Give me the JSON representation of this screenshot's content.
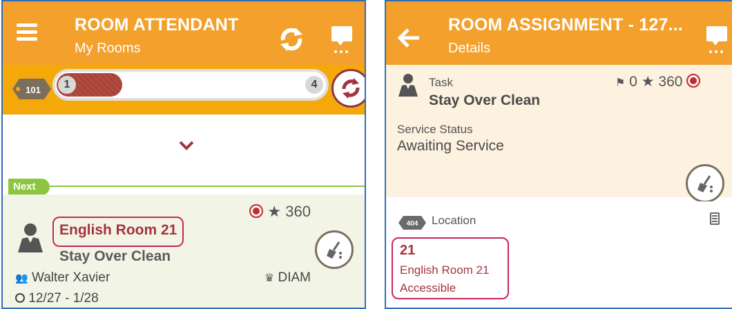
{
  "left": {
    "header": {
      "title": "ROOM ATTENDANT",
      "subtitle": "My Rooms"
    },
    "progress": {
      "room_badge": "101",
      "start": "1",
      "end": "4",
      "completed_fraction": 0.2
    },
    "next_label": "Next",
    "room": {
      "name": "English Room 21",
      "task": "Stay Over Clean",
      "score": "360",
      "guest": "Walter Xavier",
      "dates": "12/27 - 1/28",
      "vip": "DIAM"
    }
  },
  "right": {
    "header": {
      "title": "ROOM ASSIGNMENT - 127...",
      "subtitle": "Details"
    },
    "task": {
      "label": "Task",
      "value": "Stay Over Clean",
      "flag_count": "0",
      "score": "360"
    },
    "service": {
      "label": "Service Status",
      "value": "Awaiting Service"
    },
    "location": {
      "badge": "404",
      "label": "Location",
      "number": "21",
      "room_name": "English Room 21",
      "accessibility": "Accessible"
    }
  },
  "colors": {
    "appbar": "#f3a02c",
    "progress_band": "#f5a80a",
    "accent_red": "#a5333e",
    "highlight_box": "#c9245c",
    "next_green": "#8cc63f",
    "card_bg": "#f2f5e6",
    "task_bg": "#fdf1df"
  },
  "icons": [
    "hamburger-menu-icon",
    "sync-icon",
    "chat-icon",
    "room-hex-icon",
    "chevron-down-icon",
    "person-icon",
    "record-icon",
    "star-icon",
    "broom-icon",
    "group-icon",
    "circle-icon",
    "crown-icon",
    "back-arrow-icon",
    "flag-icon",
    "location-hex-icon",
    "document-icon"
  ]
}
